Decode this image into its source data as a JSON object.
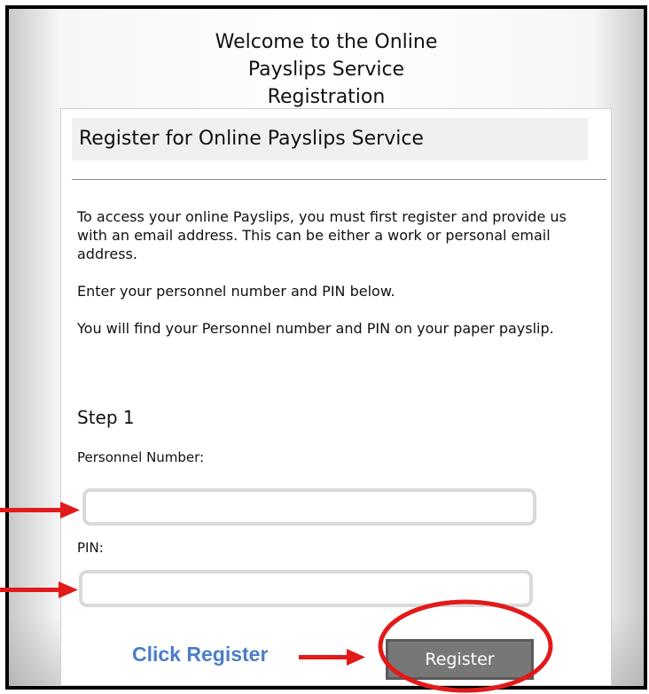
{
  "header": {
    "welcome_lines": [
      "Welcome to the Online",
      "Payslips Service",
      "Registration"
    ]
  },
  "card": {
    "title": "Register for Online Payslips Service",
    "paragraphs": [
      "To access your online Payslips, you must first register and provide us with an email address.  This can be either a work or personal email address.",
      "Enter your personnel number and PIN below.",
      "You will find your Personnel number and PIN on your paper payslip."
    ],
    "step_label": "Step 1",
    "personnel_label": "Personnel Number:",
    "personnel_value": "",
    "pin_label": "PIN:",
    "pin_value": "",
    "register_button": "Register"
  },
  "annotations": {
    "click_register": "Click Register",
    "arrow_color": "#e21a1a",
    "link_color": "#4a7ec8"
  }
}
